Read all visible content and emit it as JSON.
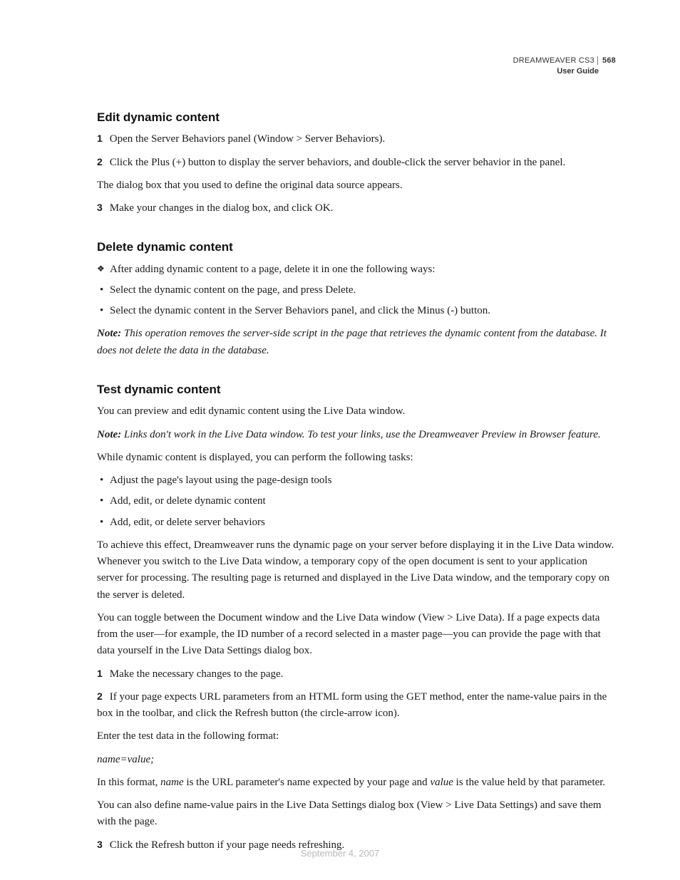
{
  "header": {
    "product": "DREAMWEAVER CS3",
    "page_number": "568",
    "doc_title": "User Guide"
  },
  "sections": {
    "edit": {
      "heading": "Edit dynamic content",
      "step1": "Open the Server Behaviors panel (Window > Server Behaviors).",
      "step2": "Click the Plus (+) button to display the server behaviors, and double-click the server behavior in the panel.",
      "after2": "The dialog box that you used to define the original data source appears.",
      "step3": "Make your changes in the dialog box, and click OK."
    },
    "delete": {
      "heading": "Delete dynamic content",
      "lead": "After adding dynamic content to a page, delete it in one the following ways:",
      "b1": "Select the dynamic content on the page, and press Delete.",
      "b2": "Select the dynamic content in the Server Behaviors panel, and click the Minus (-) button.",
      "note_label": "Note:",
      "note_body": " This operation removes the server-side script in the page that retrieves the dynamic content from the database. It does not delete the data in the database."
    },
    "test": {
      "heading": "Test dynamic content",
      "intro": "You can preview and edit dynamic content using the Live Data window.",
      "note_label": "Note:",
      "note_body": " Links don't work in the Live Data window. To test your links, use the Dreamweaver Preview in Browser feature.",
      "tasks_lead": "While dynamic content is displayed, you can perform the following tasks:",
      "t1": "Adjust the page's layout using the page-design tools",
      "t2": "Add, edit, or delete dynamic content",
      "t3": "Add, edit, or delete server behaviors",
      "para1": "To achieve this effect, Dreamweaver runs the dynamic page on your server before displaying it in the Live Data window. Whenever you switch to the Live Data window, a temporary copy of the open document is sent to your application server for processing. The resulting page is returned and displayed in the Live Data window, and the temporary copy on the server is deleted.",
      "para2": "You can toggle between the Document window and the Live Data window (View > Live Data). If a page expects data from the user—for example, the ID number of a record selected in a master page—you can provide the page with that data yourself in the Live Data Settings dialog box.",
      "step1": "Make the necessary changes to the page.",
      "step2": "If your page expects URL parameters from an HTML form using the GET method, enter the name-value pairs in the box in the toolbar, and click the Refresh button (the circle-arrow icon).",
      "after2": "Enter the test data in the following format:",
      "format": "name=value;",
      "format_expl_pre": "In this format, ",
      "format_expl_name": "name",
      "format_expl_mid": " is the URL parameter's name expected by your page and ",
      "format_expl_value": "value",
      "format_expl_post": " is the value held by that parameter.",
      "para3": "You can also define name-value pairs in the Live Data Settings dialog box (View > Live Data Settings) and save them with the page.",
      "step3": "Click the Refresh button if your page needs refreshing."
    }
  },
  "footer": {
    "date": "September 4, 2007"
  },
  "numbers": {
    "n1": "1",
    "n2": "2",
    "n3": "3"
  }
}
